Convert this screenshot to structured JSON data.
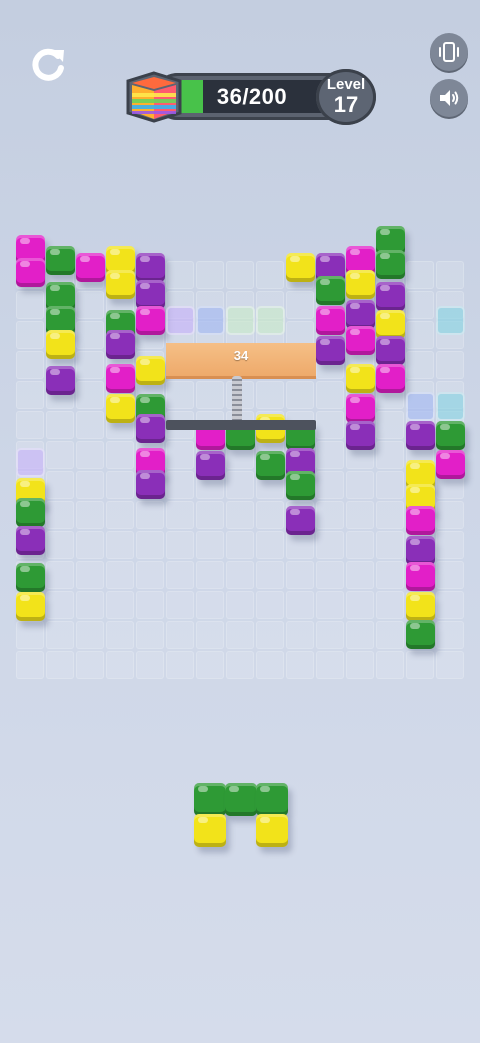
{
  "hud": {
    "progress_text": "36/200",
    "progress_fraction": 0.18,
    "level_label": "Level",
    "level_number": "17"
  },
  "icons": {
    "restart": "restart-icon",
    "vibration": "vibration-phone-icon",
    "sound": "speaker-icon",
    "cube": "rainbow-cube-icon"
  },
  "colors": {
    "magenta": "#e21fc8",
    "purple": "#8a2fb8",
    "green": "#2e9a35",
    "yellow": "#f2e31a",
    "lavender": "#c7aefc",
    "periwinkle": "#9db4f4",
    "mint": "#c9eec6",
    "teal": "#7fd3e2",
    "bar_fill": "#48c24a"
  },
  "obstacle": {
    "timer_value": "34"
  }
}
